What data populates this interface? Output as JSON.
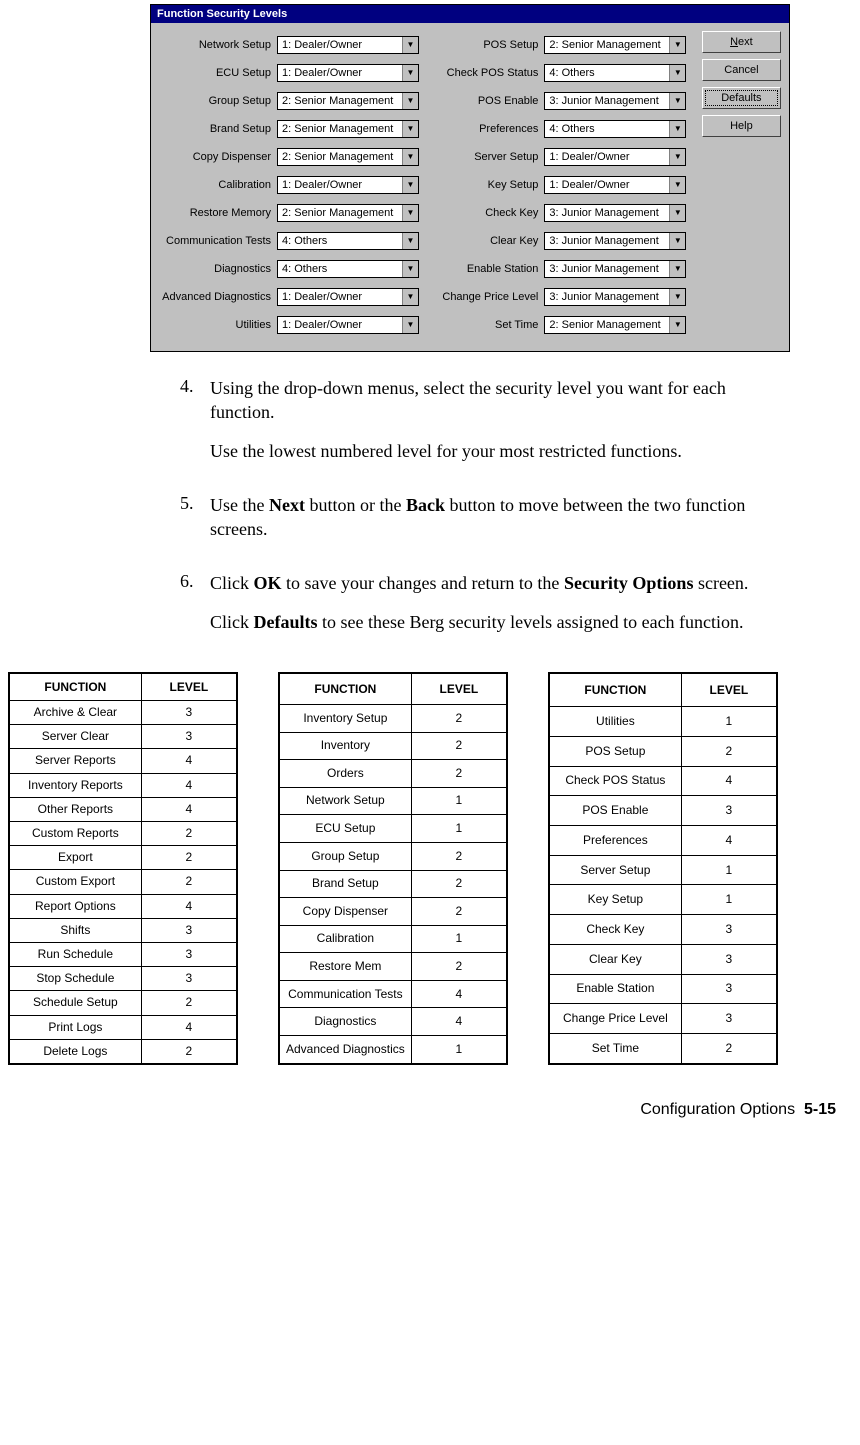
{
  "dialog": {
    "title": "Function Security Levels",
    "left": [
      {
        "label": "Network Setup",
        "value": "1: Dealer/Owner"
      },
      {
        "label": "ECU Setup",
        "value": "1: Dealer/Owner"
      },
      {
        "label": "Group Setup",
        "value": "2: Senior Management"
      },
      {
        "label": "Brand Setup",
        "value": "2: Senior Management"
      },
      {
        "label": "Copy Dispenser",
        "value": "2: Senior Management"
      },
      {
        "label": "Calibration",
        "value": "1: Dealer/Owner"
      },
      {
        "label": "Restore Memory",
        "value": "2: Senior Management"
      },
      {
        "label": "Communication Tests",
        "value": "4: Others"
      },
      {
        "label": "Diagnostics",
        "value": "4: Others"
      },
      {
        "label": "Advanced Diagnostics",
        "value": "1: Dealer/Owner"
      },
      {
        "label": "Utilities",
        "value": "1: Dealer/Owner"
      }
    ],
    "right": [
      {
        "label": "POS Setup",
        "value": "2: Senior Management"
      },
      {
        "label": "Check POS Status",
        "value": "4: Others"
      },
      {
        "label": "POS Enable",
        "value": "3: Junior Management"
      },
      {
        "label": "Preferences",
        "value": "4: Others"
      },
      {
        "label": "Server Setup",
        "value": "1: Dealer/Owner"
      },
      {
        "label": "Key Setup",
        "value": "1: Dealer/Owner"
      },
      {
        "label": "Check Key",
        "value": "3: Junior Management"
      },
      {
        "label": "Clear Key",
        "value": "3: Junior Management"
      },
      {
        "label": "Enable Station",
        "value": "3: Junior Management"
      },
      {
        "label": "Change Price Level",
        "value": "3: Junior Management"
      },
      {
        "label": "Set Time",
        "value": "2: Senior Management"
      }
    ],
    "buttons": {
      "next": "Next",
      "cancel": "Cancel",
      "defaults": "Defaults",
      "help": "Help"
    }
  },
  "steps": {
    "s4a": "Using the drop-down menus, select the security level you want for each function.",
    "s4b": "Use the lowest numbered level for your most restricted functions.",
    "s5a": "Use the ",
    "s5b": " button or the ",
    "s5c": " button to move between the two function screens.",
    "s6a": "Click ",
    "s6b": " to save your changes and return to the ",
    "s6c": " screen.",
    "s6d": "Click ",
    "s6e": " to see these Berg security levels assigned to each function.",
    "bold": {
      "next": "Next",
      "back": "Back",
      "ok": "OK",
      "secopts": "Security Options",
      "defaults": "Defaults"
    }
  },
  "tables": {
    "head_fn": "FUNCTION",
    "head_lv": "LEVEL",
    "t1": [
      {
        "f": "Archive & Clear",
        "l": "3"
      },
      {
        "f": "Server Clear",
        "l": "3"
      },
      {
        "f": "Server Reports",
        "l": "4"
      },
      {
        "f": "Inventory Reports",
        "l": "4"
      },
      {
        "f": "Other Reports",
        "l": "4"
      },
      {
        "f": "Custom Reports",
        "l": "2"
      },
      {
        "f": "Export",
        "l": "2"
      },
      {
        "f": "Custom Export",
        "l": "2"
      },
      {
        "f": "Report Options",
        "l": "4"
      },
      {
        "f": "Shifts",
        "l": "3"
      },
      {
        "f": "Run Schedule",
        "l": "3"
      },
      {
        "f": "Stop Schedule",
        "l": "3"
      },
      {
        "f": "Schedule Setup",
        "l": "2"
      },
      {
        "f": "Print Logs",
        "l": "4"
      },
      {
        "f": "Delete Logs",
        "l": "2"
      }
    ],
    "t2": [
      {
        "f": "Inventory Setup",
        "l": "2"
      },
      {
        "f": "Inventory",
        "l": "2"
      },
      {
        "f": "Orders",
        "l": "2"
      },
      {
        "f": "Network Setup",
        "l": "1"
      },
      {
        "f": "ECU Setup",
        "l": "1"
      },
      {
        "f": "Group Setup",
        "l": "2"
      },
      {
        "f": "Brand Setup",
        "l": "2"
      },
      {
        "f": "Copy Dispenser",
        "l": "2"
      },
      {
        "f": "Calibration",
        "l": "1"
      },
      {
        "f": "Restore Mem",
        "l": "2"
      },
      {
        "f": "Communication Tests",
        "l": "4"
      },
      {
        "f": "Diagnostics",
        "l": "4"
      },
      {
        "f": "Advanced Diagnostics",
        "l": "1"
      }
    ],
    "t3": [
      {
        "f": "Utilities",
        "l": "1"
      },
      {
        "f": "POS Setup",
        "l": "2"
      },
      {
        "f": "Check POS Status",
        "l": "4"
      },
      {
        "f": "POS Enable",
        "l": "3"
      },
      {
        "f": "Preferences",
        "l": "4"
      },
      {
        "f": "Server Setup",
        "l": "1"
      },
      {
        "f": "Key Setup",
        "l": "1"
      },
      {
        "f": "Check Key",
        "l": "3"
      },
      {
        "f": "Clear Key",
        "l": "3"
      },
      {
        "f": "Enable Station",
        "l": "3"
      },
      {
        "f": "Change Price Level",
        "l": "3"
      },
      {
        "f": "Set Time",
        "l": "2"
      }
    ]
  },
  "footer": {
    "text": "Configuration Options",
    "page": "5-15"
  }
}
